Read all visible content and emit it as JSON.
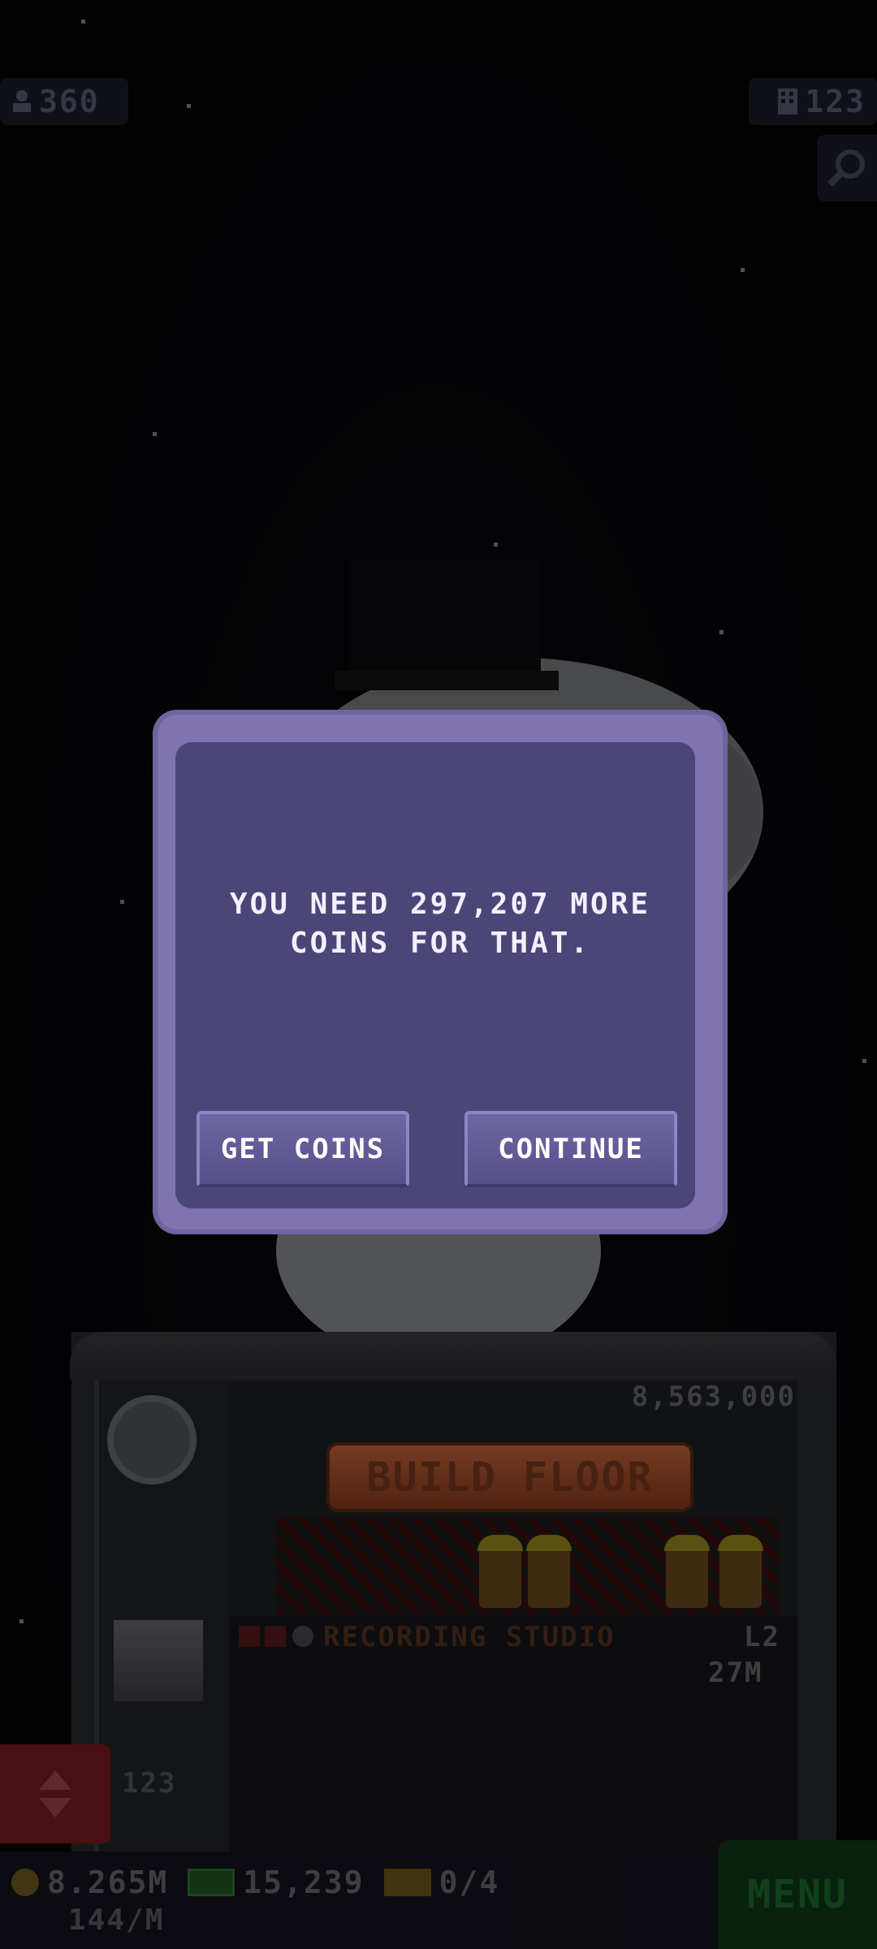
{
  "top_bar": {
    "population": "360",
    "population_icon": "person-icon",
    "floors": "123",
    "floors_icon": "building-icon",
    "search_icon": "magnifier-icon"
  },
  "tower": {
    "build_cost": "8,563,000",
    "build_floor_label": "BUILD FLOOR",
    "floor_name": "RECORDING STUDIO",
    "floor_level": "L2",
    "floor_income": "27M",
    "elevator_floor": "123"
  },
  "dialog": {
    "message": "YOU NEED 297,207 MORE COINS FOR THAT.",
    "get_coins_label": "GET COINS",
    "continue_label": "CONTINUE"
  },
  "bottom_bar": {
    "coins": "8.265M",
    "coin_rate": "144/M",
    "bux": "15,239",
    "tickets": "0/4",
    "menu_label": "MENU"
  },
  "colors": {
    "dialog_frame": "#7f73b2",
    "dialog_body": "#4b4677",
    "button": "#6f67a4",
    "menu": "#1d6e2e"
  }
}
